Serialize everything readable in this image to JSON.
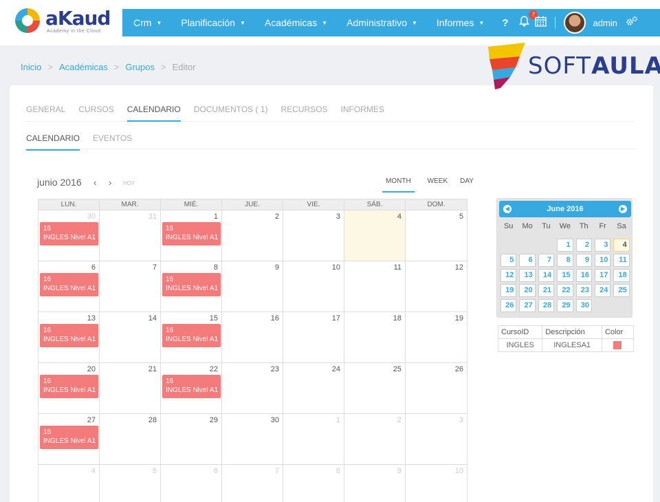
{
  "brand": {
    "name": "aKaud",
    "tagline": "Academy in the Cloud"
  },
  "nav": {
    "items": [
      {
        "label": "Crm"
      },
      {
        "label": "Planificación"
      },
      {
        "label": "Académicas"
      },
      {
        "label": "Administrativo"
      },
      {
        "label": "Informes"
      }
    ],
    "help": "?",
    "notification_count": "7",
    "user": "admin"
  },
  "breadcrumb": [
    "Inicio",
    "Académicas",
    "Grupos",
    "Editor"
  ],
  "watermark": {
    "part1": "SOFT",
    "part2": "AULA"
  },
  "tabs": [
    "GENERAL",
    "CURSOS",
    "CALENDARIO",
    "DOCUMENTOS ( 1)",
    "RECURSOS",
    "INFORMES"
  ],
  "subtabs": [
    "CALENDARIO",
    "EVENTOS"
  ],
  "calendar": {
    "title": "junio 2016",
    "prev": "‹",
    "next": "›",
    "today": "HOY",
    "views": [
      "MONTH",
      "WEEK",
      "DAY"
    ],
    "dow": [
      "LUN.",
      "MAR.",
      "MIÉ.",
      "JUE.",
      "VIE.",
      "SÁB.",
      "DOM."
    ],
    "weeks": [
      [
        {
          "n": "30",
          "o": true
        },
        {
          "n": "31",
          "o": true
        },
        {
          "n": "1"
        },
        {
          "n": "2"
        },
        {
          "n": "3"
        },
        {
          "n": "4"
        },
        {
          "n": "5"
        }
      ],
      [
        {
          "n": "6"
        },
        {
          "n": "7"
        },
        {
          "n": "8"
        },
        {
          "n": "9"
        },
        {
          "n": "10"
        },
        {
          "n": "11"
        },
        {
          "n": "12"
        }
      ],
      [
        {
          "n": "13"
        },
        {
          "n": "14"
        },
        {
          "n": "15"
        },
        {
          "n": "16"
        },
        {
          "n": "17"
        },
        {
          "n": "18"
        },
        {
          "n": "19"
        }
      ],
      [
        {
          "n": "20"
        },
        {
          "n": "21"
        },
        {
          "n": "22"
        },
        {
          "n": "23"
        },
        {
          "n": "24"
        },
        {
          "n": "25"
        },
        {
          "n": "26"
        }
      ],
      [
        {
          "n": "27"
        },
        {
          "n": "28"
        },
        {
          "n": "29"
        },
        {
          "n": "30"
        },
        {
          "n": "1",
          "o": true
        },
        {
          "n": "2",
          "o": true
        },
        {
          "n": "3",
          "o": true
        }
      ],
      [
        {
          "n": "4",
          "o": true
        },
        {
          "n": "5",
          "o": true
        },
        {
          "n": "6",
          "o": true
        },
        {
          "n": "7",
          "o": true
        },
        {
          "n": "8",
          "o": true
        },
        {
          "n": "9",
          "o": true
        },
        {
          "n": "10",
          "o": true
        }
      ]
    ],
    "highlight": "4",
    "event": {
      "line1": "16",
      "line2": "INGLES Nivel A1",
      "color": "#f47b7b"
    },
    "events": [
      {
        "week": 0,
        "day": 0
      },
      {
        "week": 0,
        "day": 2
      },
      {
        "week": 1,
        "day": 0
      },
      {
        "week": 1,
        "day": 2
      },
      {
        "week": 2,
        "day": 0
      },
      {
        "week": 2,
        "day": 2
      },
      {
        "week": 3,
        "day": 0
      },
      {
        "week": 3,
        "day": 2
      },
      {
        "week": 4,
        "day": 0
      }
    ]
  },
  "mini_calendar": {
    "title": "June 2016",
    "dow": [
      "Su",
      "Mo",
      "Tu",
      "We",
      "Th",
      "Fr",
      "Sa"
    ],
    "days": [
      "",
      "",
      "",
      "1",
      "2",
      "3",
      "4",
      "5",
      "6",
      "7",
      "8",
      "9",
      "10",
      "11",
      "12",
      "13",
      "14",
      "15",
      "16",
      "17",
      "18",
      "19",
      "20",
      "21",
      "22",
      "23",
      "24",
      "25",
      "26",
      "27",
      "28",
      "29",
      "30"
    ],
    "today": "4"
  },
  "courses_table": {
    "headers": [
      "CursoID",
      "Descripción",
      "Color"
    ],
    "rows": [
      {
        "id": "INGLES",
        "desc": "INGLESA1",
        "color": "#f47b7b"
      }
    ]
  },
  "colors": {
    "accent": "#36a9e1",
    "event": "#f47b7b",
    "highlight": "#fcf8e3"
  }
}
